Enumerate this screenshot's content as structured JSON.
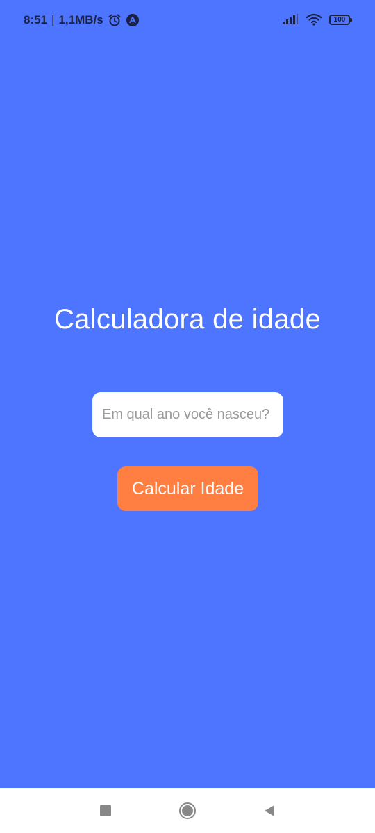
{
  "status_bar": {
    "time": "8:51",
    "separator": "|",
    "net_speed": "1,1MB/s",
    "battery_level": "100",
    "icons": [
      "alarm-icon",
      "app-a-icon",
      "signal-icon",
      "wifi-icon",
      "battery-icon"
    ]
  },
  "main": {
    "title": "Calculadora de idade",
    "input_placeholder": "Em qual ano você nasceu?",
    "input_value": "",
    "button_label": "Calcular Idade"
  },
  "nav_bar": {
    "icons": [
      "recent-apps-icon",
      "home-icon",
      "back-icon"
    ]
  },
  "colors": {
    "background": "#4E75FF",
    "button": "#FF7E42",
    "input_bg": "#FFFFFF",
    "title_text": "#FFFFFF"
  }
}
